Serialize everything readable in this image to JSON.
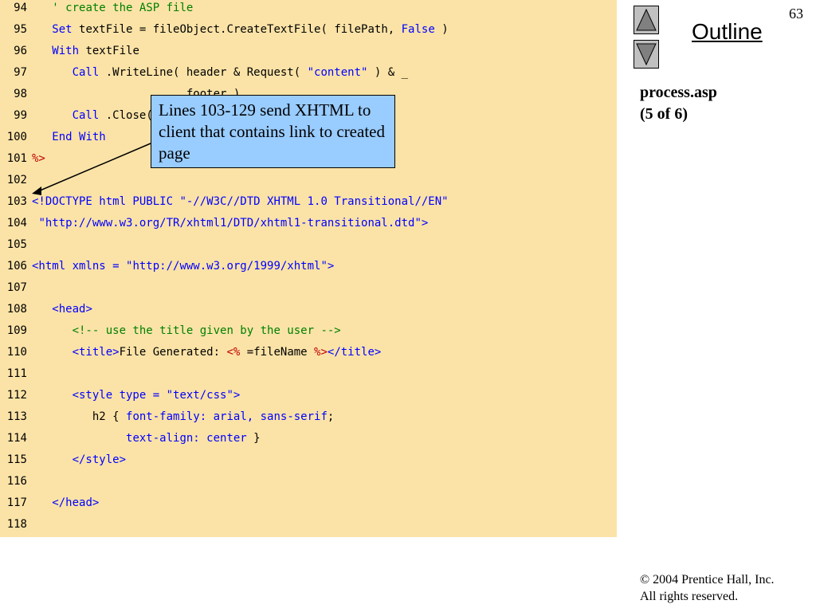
{
  "slide": {
    "page_number": "63",
    "outline_label": "Outline",
    "file_title_line1": "process.asp",
    "file_title_line2": "(5 of 6)",
    "callout": "Lines 103-129 send XHTML to client that contains link to created page",
    "copyright_line1": "© 2004 Prentice Hall, Inc.",
    "copyright_line2": "All rights reserved."
  },
  "nav": {
    "up_icon": "triangle-up-icon",
    "down_icon": "triangle-down-icon"
  },
  "colors": {
    "code_background": "#fbe3a7",
    "keyword": "#0000ff",
    "comment": "#008000",
    "asp_delimiter": "#c00000",
    "callout_background": "#99ccff"
  },
  "code_lines": [
    {
      "n": "94",
      "segs": [
        {
          "t": "   ",
          "c": ""
        },
        {
          "t": "' create the ASP file",
          "c": "c"
        }
      ]
    },
    {
      "n": "95",
      "segs": [
        {
          "t": "   ",
          "c": ""
        },
        {
          "t": "Set",
          "c": "k"
        },
        {
          "t": " textFile = fileObject.CreateTextFile( filePath, ",
          "c": ""
        },
        {
          "t": "False",
          "c": "k"
        },
        {
          "t": " )",
          "c": ""
        }
      ]
    },
    {
      "n": "96",
      "segs": [
        {
          "t": "   ",
          "c": ""
        },
        {
          "t": "With",
          "c": "k"
        },
        {
          "t": " textFile",
          "c": ""
        }
      ]
    },
    {
      "n": "97",
      "segs": [
        {
          "t": "      ",
          "c": ""
        },
        {
          "t": "Call",
          "c": "k"
        },
        {
          "t": " .WriteLine( header & Request( ",
          "c": ""
        },
        {
          "t": "\"content\"",
          "c": "s"
        },
        {
          "t": " ) & _",
          "c": ""
        }
      ]
    },
    {
      "n": "98",
      "segs": [
        {
          "t": "                       footer )",
          "c": ""
        }
      ]
    },
    {
      "n": "99",
      "segs": [
        {
          "t": "      ",
          "c": ""
        },
        {
          "t": "Call",
          "c": "k"
        },
        {
          "t": " .Close()",
          "c": ""
        }
      ]
    },
    {
      "n": "100",
      "segs": [
        {
          "t": "   ",
          "c": ""
        },
        {
          "t": "End With",
          "c": "k"
        }
      ]
    },
    {
      "n": "101",
      "segs": [
        {
          "t": "%>",
          "c": "d"
        }
      ]
    },
    {
      "n": "102",
      "segs": []
    },
    {
      "n": "103",
      "segs": [
        {
          "t": "<!DOCTYPE html PUBLIC ",
          "c": "t"
        },
        {
          "t": "\"-//W3C//DTD XHTML 1.0 Transitional//EN\"",
          "c": "s"
        }
      ]
    },
    {
      "n": "104",
      "segs": [
        {
          "t": " ",
          "c": ""
        },
        {
          "t": "\"http://www.w3.org/TR/xhtml1/DTD/xhtml1-transitional.dtd\"",
          "c": "s"
        },
        {
          "t": ">",
          "c": "t"
        }
      ]
    },
    {
      "n": "105",
      "segs": []
    },
    {
      "n": "106",
      "segs": [
        {
          "t": "<html xmlns = ",
          "c": "t"
        },
        {
          "t": "\"http://www.w3.org/1999/xhtml\"",
          "c": "s"
        },
        {
          "t": ">",
          "c": "t"
        }
      ]
    },
    {
      "n": "107",
      "segs": []
    },
    {
      "n": "108",
      "segs": [
        {
          "t": "   ",
          "c": ""
        },
        {
          "t": "<head>",
          "c": "t"
        }
      ]
    },
    {
      "n": "109",
      "segs": [
        {
          "t": "      ",
          "c": ""
        },
        {
          "t": "<!-- use the title given by the user -->",
          "c": "c"
        }
      ]
    },
    {
      "n": "110",
      "segs": [
        {
          "t": "      ",
          "c": ""
        },
        {
          "t": "<title>",
          "c": "t"
        },
        {
          "t": "File Generated: ",
          "c": ""
        },
        {
          "t": "<%",
          "c": "d"
        },
        {
          "t": " =fileName ",
          "c": ""
        },
        {
          "t": "%>",
          "c": "d"
        },
        {
          "t": "</title>",
          "c": "t"
        }
      ]
    },
    {
      "n": "111",
      "segs": []
    },
    {
      "n": "112",
      "segs": [
        {
          "t": "      ",
          "c": ""
        },
        {
          "t": "<style type = ",
          "c": "t"
        },
        {
          "t": "\"text/css\"",
          "c": "s"
        },
        {
          "t": ">",
          "c": "t"
        }
      ]
    },
    {
      "n": "113",
      "segs": [
        {
          "t": "         h2 { ",
          "c": ""
        },
        {
          "t": "font-family:",
          "c": "k"
        },
        {
          "t": " arial, sans-serif",
          "c": "s"
        },
        {
          "t": ";",
          "c": ""
        }
      ]
    },
    {
      "n": "114",
      "segs": [
        {
          "t": "              ",
          "c": ""
        },
        {
          "t": "text-align:",
          "c": "k"
        },
        {
          "t": " center",
          "c": "s"
        },
        {
          "t": " }",
          "c": ""
        }
      ]
    },
    {
      "n": "115",
      "segs": [
        {
          "t": "      ",
          "c": ""
        },
        {
          "t": "</style>",
          "c": "t"
        }
      ]
    },
    {
      "n": "116",
      "segs": []
    },
    {
      "n": "117",
      "segs": [
        {
          "t": "   ",
          "c": ""
        },
        {
          "t": "</head>",
          "c": "t"
        }
      ]
    },
    {
      "n": "118",
      "segs": []
    }
  ]
}
